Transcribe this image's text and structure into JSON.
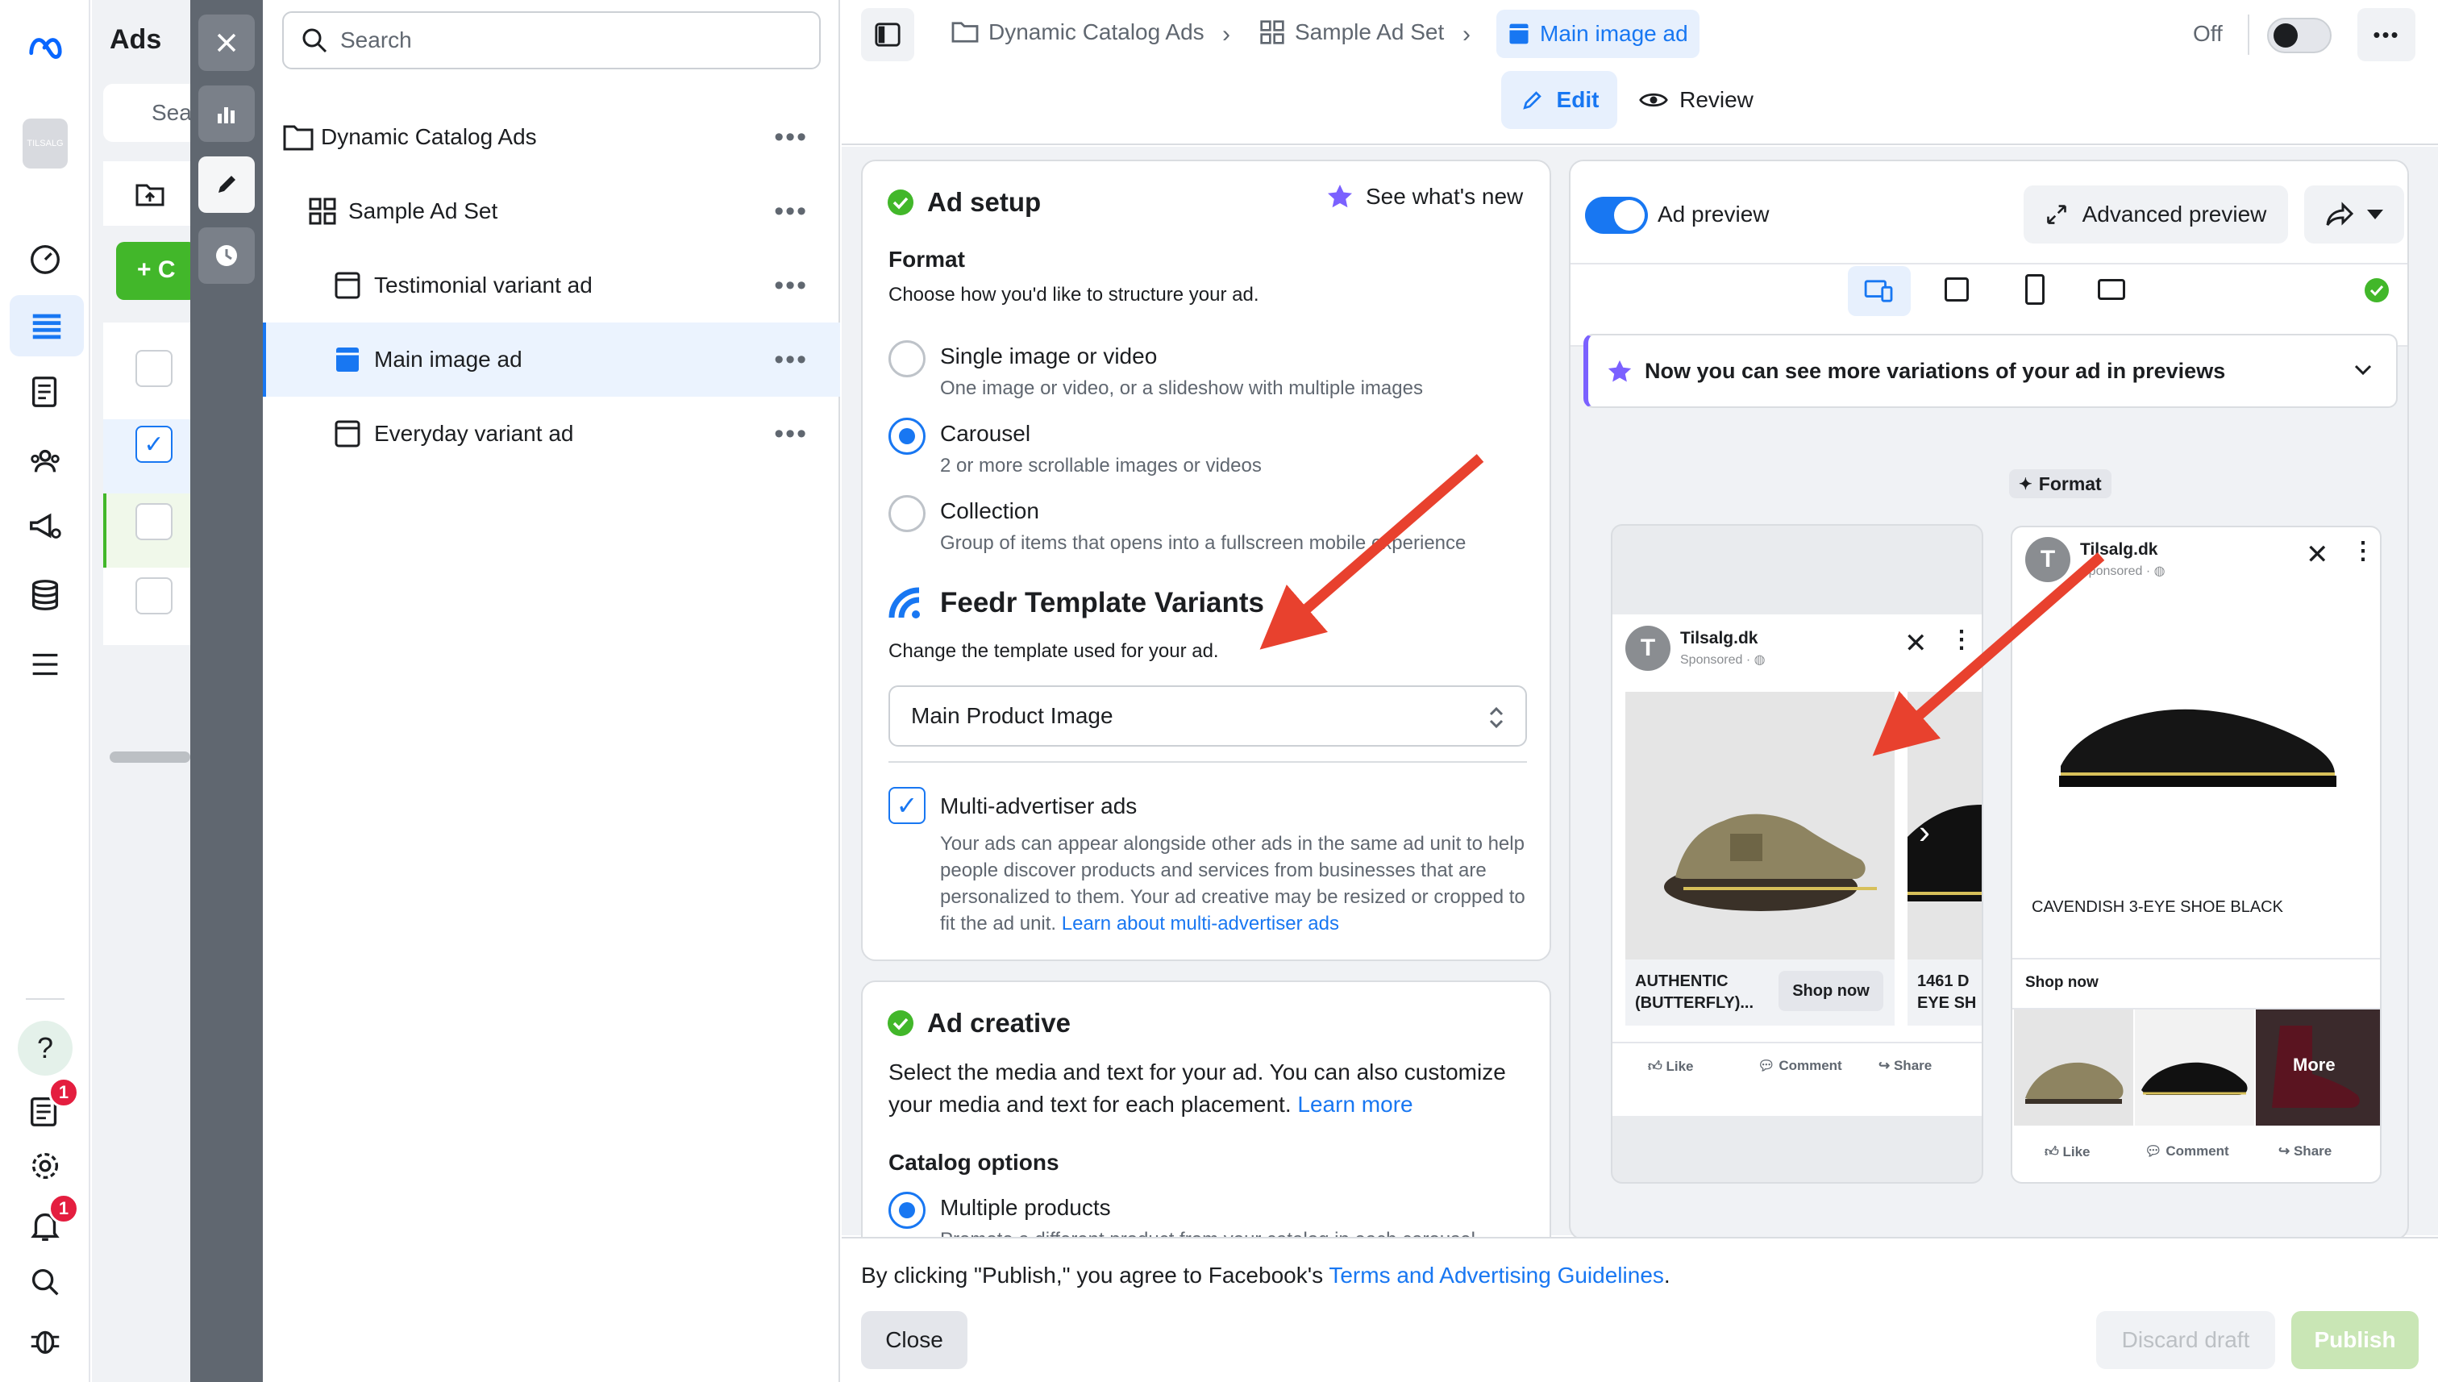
{
  "app": {
    "title": "Ads",
    "search_placeholder_partial": "Sea",
    "create_partial": "C"
  },
  "colors": {
    "brand": "#1877f2",
    "success": "#42b72a",
    "danger": "#e41e3f",
    "arrow": "#e8412e"
  },
  "rail": {
    "notifications_badge": "1",
    "alerts_badge": "1",
    "avatar_text": "TILSALG"
  },
  "tree": {
    "search_placeholder": "Search",
    "items": [
      {
        "label": "Dynamic Catalog Ads",
        "icon": "folder-icon"
      },
      {
        "label": "Sample Ad Set",
        "icon": "grid-icon"
      },
      {
        "label": "Testimonial variant ad",
        "icon": "ad-icon"
      },
      {
        "label": "Main image ad",
        "icon": "ad-icon"
      },
      {
        "label": "Everyday variant ad",
        "icon": "ad-icon"
      }
    ]
  },
  "topbar": {
    "breadcrumbs": [
      "Dynamic Catalog Ads",
      "Sample Ad Set",
      "Main image ad"
    ],
    "toggle_label": "Off",
    "edit_tab": "Edit",
    "review_tab": "Review"
  },
  "ad_setup": {
    "title": "Ad setup",
    "whats_new": "See what's new",
    "format_heading": "Format",
    "format_desc": "Choose how you'd like to structure your ad.",
    "options": [
      {
        "label": "Single image or video",
        "desc": "One image or video, or a slideshow with multiple images",
        "selected": false
      },
      {
        "label": "Carousel",
        "desc": "2 or more scrollable images or videos",
        "selected": true
      },
      {
        "label": "Collection",
        "desc": "Group of items that opens into a fullscreen mobile experience",
        "selected": false
      }
    ],
    "feedr_title": "Feedr Template Variants",
    "feedr_desc": "Change the template used for your ad.",
    "template_value": "Main Product Image",
    "multi_label": "Multi-advertiser ads",
    "multi_desc": "Your ads can appear alongside other ads in the same ad unit to help people discover products and services from businesses that are personalized to them. Your ad creative may be resized or cropped to fit the ad unit.",
    "multi_link": "Learn about multi-advertiser ads"
  },
  "ad_creative": {
    "title": "Ad creative",
    "desc": "Select the media and text for your ad. You can also customize your media and text for each placement.",
    "learn_more": "Learn more",
    "catalog_heading": "Catalog options",
    "catalog_option": "Multiple products",
    "catalog_option_desc": "Promote a different product from your catalog in each carousel"
  },
  "preview": {
    "label": "Ad preview",
    "advanced": "Advanced preview",
    "banner": "Now you can see more variations of your ad in previews",
    "format_chip": "Format",
    "left": {
      "brand": "Tilsalg.dk",
      "sponsored": "Sponsored · ◍",
      "card1_title": "AUTHENTIC (BUTTERFLY)...",
      "cta": "Shop now",
      "card2_title": "1461 D EYE SH",
      "actions": [
        "Like",
        "Comment",
        "Share"
      ]
    },
    "right": {
      "brand": "Tilsalg.dk",
      "sponsored": "Sponsored · ◍",
      "product_name": "CAVENDISH 3-EYE SHOE BLACK",
      "cta": "Shop now",
      "more": "More",
      "actions": [
        "Like",
        "Comment",
        "Share"
      ]
    }
  },
  "footer": {
    "consent_prefix": "By clicking \"Publish,\" you agree to Facebook's ",
    "consent_link": "Terms and Advertising Guidelines",
    "consent_suffix": ".",
    "close": "Close",
    "discard": "Discard draft",
    "publish": "Publish"
  }
}
